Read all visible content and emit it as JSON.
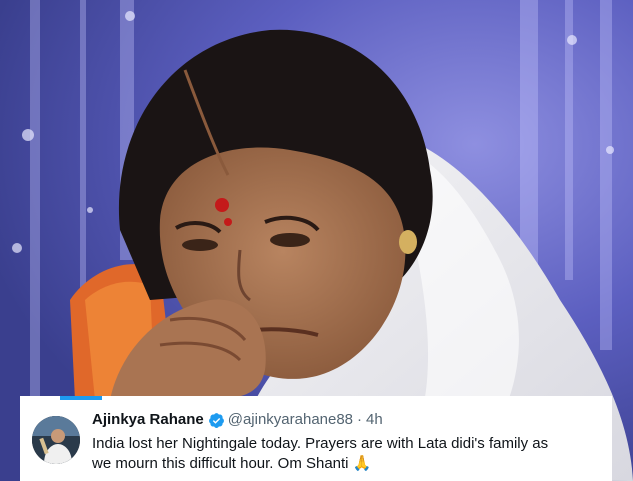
{
  "tweet": {
    "display_name": "Ajinkya Rahane",
    "handle": "@ajinkyarahane88",
    "separator": "·",
    "timestamp": "4h",
    "text": "India lost her Nightingale today. Prayers are with Lata didi's family as we mourn this difficult hour. Om Shanti",
    "emoji": "🙏",
    "verified": true,
    "avatar_icon": "user-avatar",
    "verified_icon": "verified-badge-icon"
  },
  "photo": {
    "subject": "woman-portrait-photo"
  },
  "colors": {
    "twitter_blue": "#1d9bf0",
    "text_primary": "#0f1419",
    "text_secondary": "#536471",
    "background_blue": "#5a63b8"
  }
}
